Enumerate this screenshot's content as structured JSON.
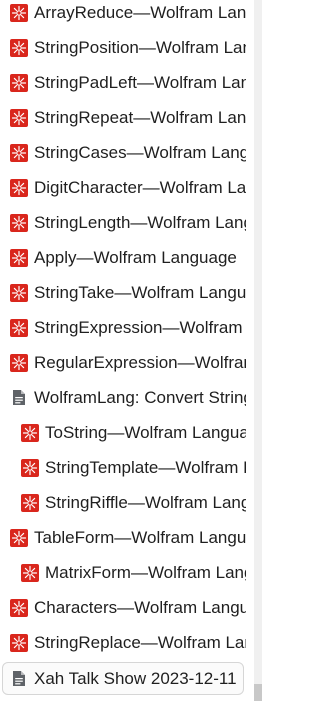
{
  "sidebar": {
    "items": [
      {
        "label": "ArrayReduce—Wolfram Language",
        "icon": "wolfram-icon",
        "level": 0
      },
      {
        "label": "StringPosition—Wolfram Language",
        "icon": "wolfram-icon",
        "level": 0
      },
      {
        "label": "StringPadLeft—Wolfram Language",
        "icon": "wolfram-icon",
        "level": 0
      },
      {
        "label": "StringRepeat—Wolfram Language",
        "icon": "wolfram-icon",
        "level": 0
      },
      {
        "label": "StringCases—Wolfram Language",
        "icon": "wolfram-icon",
        "level": 0
      },
      {
        "label": "DigitCharacter—Wolfram Language",
        "icon": "wolfram-icon",
        "level": 0
      },
      {
        "label": "StringLength—Wolfram Language",
        "icon": "wolfram-icon",
        "level": 0
      },
      {
        "label": "Apply—Wolfram Language",
        "icon": "wolfram-icon",
        "level": 0
      },
      {
        "label": "StringTake—Wolfram Language",
        "icon": "wolfram-icon",
        "level": 0
      },
      {
        "label": "StringExpression—Wolfram Language",
        "icon": "wolfram-icon",
        "level": 0
      },
      {
        "label": "RegularExpression—Wolfram Language",
        "icon": "wolfram-icon",
        "level": 0
      },
      {
        "label": "WolframLang: Convert String",
        "icon": "document-icon",
        "level": 0
      },
      {
        "label": "ToString—Wolfram Language",
        "icon": "wolfram-icon",
        "level": 1
      },
      {
        "label": "StringTemplate—Wolfram Language",
        "icon": "wolfram-icon",
        "level": 1
      },
      {
        "label": "StringRiffle—Wolfram Language",
        "icon": "wolfram-icon",
        "level": 1
      },
      {
        "label": "TableForm—Wolfram Language",
        "icon": "wolfram-icon",
        "level": 0
      },
      {
        "label": "MatrixForm—Wolfram Language",
        "icon": "wolfram-icon",
        "level": 1
      },
      {
        "label": "Characters—Wolfram Language",
        "icon": "wolfram-icon",
        "level": 0
      },
      {
        "label": "StringReplace—Wolfram Language",
        "icon": "wolfram-icon",
        "level": 0
      },
      {
        "label": "Xah Talk Show 2023-12-11",
        "icon": "document-icon",
        "level": 0,
        "active": true
      }
    ]
  },
  "colors": {
    "wolfram_red": "#d9261c",
    "document_gray": "#5f6368",
    "text": "#1f1f1f"
  }
}
